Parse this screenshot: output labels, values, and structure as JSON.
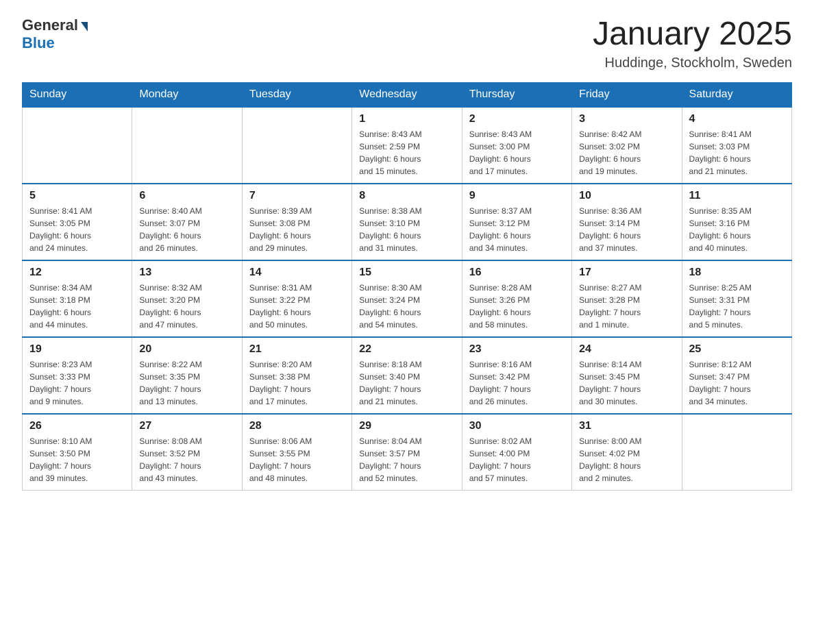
{
  "logo": {
    "general": "General",
    "blue": "Blue"
  },
  "header": {
    "title": "January 2025",
    "subtitle": "Huddinge, Stockholm, Sweden"
  },
  "weekdays": [
    "Sunday",
    "Monday",
    "Tuesday",
    "Wednesday",
    "Thursday",
    "Friday",
    "Saturday"
  ],
  "weeks": [
    [
      {
        "day": "",
        "info": ""
      },
      {
        "day": "",
        "info": ""
      },
      {
        "day": "",
        "info": ""
      },
      {
        "day": "1",
        "info": "Sunrise: 8:43 AM\nSunset: 2:59 PM\nDaylight: 6 hours\nand 15 minutes."
      },
      {
        "day": "2",
        "info": "Sunrise: 8:43 AM\nSunset: 3:00 PM\nDaylight: 6 hours\nand 17 minutes."
      },
      {
        "day": "3",
        "info": "Sunrise: 8:42 AM\nSunset: 3:02 PM\nDaylight: 6 hours\nand 19 minutes."
      },
      {
        "day": "4",
        "info": "Sunrise: 8:41 AM\nSunset: 3:03 PM\nDaylight: 6 hours\nand 21 minutes."
      }
    ],
    [
      {
        "day": "5",
        "info": "Sunrise: 8:41 AM\nSunset: 3:05 PM\nDaylight: 6 hours\nand 24 minutes."
      },
      {
        "day": "6",
        "info": "Sunrise: 8:40 AM\nSunset: 3:07 PM\nDaylight: 6 hours\nand 26 minutes."
      },
      {
        "day": "7",
        "info": "Sunrise: 8:39 AM\nSunset: 3:08 PM\nDaylight: 6 hours\nand 29 minutes."
      },
      {
        "day": "8",
        "info": "Sunrise: 8:38 AM\nSunset: 3:10 PM\nDaylight: 6 hours\nand 31 minutes."
      },
      {
        "day": "9",
        "info": "Sunrise: 8:37 AM\nSunset: 3:12 PM\nDaylight: 6 hours\nand 34 minutes."
      },
      {
        "day": "10",
        "info": "Sunrise: 8:36 AM\nSunset: 3:14 PM\nDaylight: 6 hours\nand 37 minutes."
      },
      {
        "day": "11",
        "info": "Sunrise: 8:35 AM\nSunset: 3:16 PM\nDaylight: 6 hours\nand 40 minutes."
      }
    ],
    [
      {
        "day": "12",
        "info": "Sunrise: 8:34 AM\nSunset: 3:18 PM\nDaylight: 6 hours\nand 44 minutes."
      },
      {
        "day": "13",
        "info": "Sunrise: 8:32 AM\nSunset: 3:20 PM\nDaylight: 6 hours\nand 47 minutes."
      },
      {
        "day": "14",
        "info": "Sunrise: 8:31 AM\nSunset: 3:22 PM\nDaylight: 6 hours\nand 50 minutes."
      },
      {
        "day": "15",
        "info": "Sunrise: 8:30 AM\nSunset: 3:24 PM\nDaylight: 6 hours\nand 54 minutes."
      },
      {
        "day": "16",
        "info": "Sunrise: 8:28 AM\nSunset: 3:26 PM\nDaylight: 6 hours\nand 58 minutes."
      },
      {
        "day": "17",
        "info": "Sunrise: 8:27 AM\nSunset: 3:28 PM\nDaylight: 7 hours\nand 1 minute."
      },
      {
        "day": "18",
        "info": "Sunrise: 8:25 AM\nSunset: 3:31 PM\nDaylight: 7 hours\nand 5 minutes."
      }
    ],
    [
      {
        "day": "19",
        "info": "Sunrise: 8:23 AM\nSunset: 3:33 PM\nDaylight: 7 hours\nand 9 minutes."
      },
      {
        "day": "20",
        "info": "Sunrise: 8:22 AM\nSunset: 3:35 PM\nDaylight: 7 hours\nand 13 minutes."
      },
      {
        "day": "21",
        "info": "Sunrise: 8:20 AM\nSunset: 3:38 PM\nDaylight: 7 hours\nand 17 minutes."
      },
      {
        "day": "22",
        "info": "Sunrise: 8:18 AM\nSunset: 3:40 PM\nDaylight: 7 hours\nand 21 minutes."
      },
      {
        "day": "23",
        "info": "Sunrise: 8:16 AM\nSunset: 3:42 PM\nDaylight: 7 hours\nand 26 minutes."
      },
      {
        "day": "24",
        "info": "Sunrise: 8:14 AM\nSunset: 3:45 PM\nDaylight: 7 hours\nand 30 minutes."
      },
      {
        "day": "25",
        "info": "Sunrise: 8:12 AM\nSunset: 3:47 PM\nDaylight: 7 hours\nand 34 minutes."
      }
    ],
    [
      {
        "day": "26",
        "info": "Sunrise: 8:10 AM\nSunset: 3:50 PM\nDaylight: 7 hours\nand 39 minutes."
      },
      {
        "day": "27",
        "info": "Sunrise: 8:08 AM\nSunset: 3:52 PM\nDaylight: 7 hours\nand 43 minutes."
      },
      {
        "day": "28",
        "info": "Sunrise: 8:06 AM\nSunset: 3:55 PM\nDaylight: 7 hours\nand 48 minutes."
      },
      {
        "day": "29",
        "info": "Sunrise: 8:04 AM\nSunset: 3:57 PM\nDaylight: 7 hours\nand 52 minutes."
      },
      {
        "day": "30",
        "info": "Sunrise: 8:02 AM\nSunset: 4:00 PM\nDaylight: 7 hours\nand 57 minutes."
      },
      {
        "day": "31",
        "info": "Sunrise: 8:00 AM\nSunset: 4:02 PM\nDaylight: 8 hours\nand 2 minutes."
      },
      {
        "day": "",
        "info": ""
      }
    ]
  ]
}
